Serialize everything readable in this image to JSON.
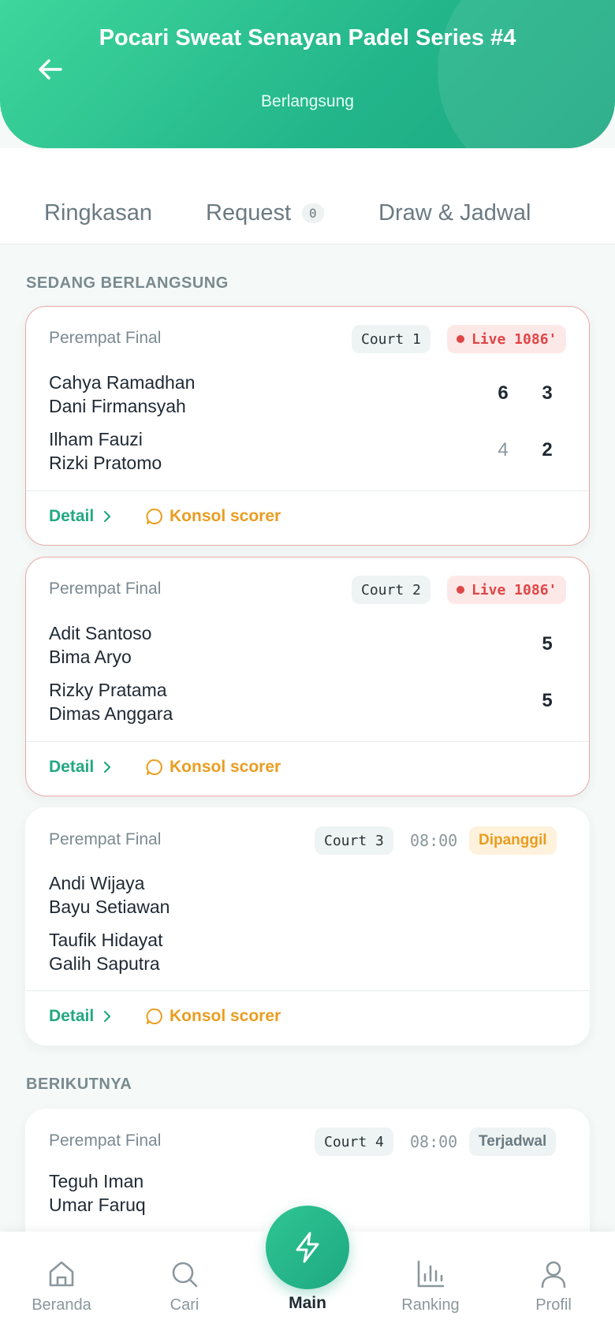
{
  "header": {
    "title": "Pocari Sweat Senayan Padel Series #4",
    "status": "Berlangsung"
  },
  "tabs": [
    {
      "label": "Ringkasan"
    },
    {
      "label": "Request",
      "count": "0"
    },
    {
      "label": "Draw & Jadwal"
    }
  ],
  "sections": {
    "ongoing": "SEDANG BERLANGSUNG",
    "next": "BERIKUTNYA"
  },
  "matches": [
    {
      "round": "Perempat Final",
      "court": "Court 1",
      "status": "Live 1086'",
      "team1": [
        "Cahya Ramadhan",
        "Dani Firmansyah"
      ],
      "team2": [
        "Ilham Fauzi",
        "Rizki Pratomo"
      ],
      "score1": [
        "6",
        "3"
      ],
      "score2": [
        "4",
        "2"
      ],
      "detail": "Detail",
      "scorer": "Konsol scorer"
    },
    {
      "round": "Perempat Final",
      "court": "Court 2",
      "status": "Live 1086'",
      "team1": [
        "Adit Santoso",
        "Bima Aryo"
      ],
      "team2": [
        "Rizky Pratama",
        "Dimas Anggara"
      ],
      "score1": [
        "5"
      ],
      "score2": [
        "5"
      ],
      "detail": "Detail",
      "scorer": "Konsol scorer"
    },
    {
      "round": "Perempat Final",
      "court": "Court 3",
      "time": "08:00",
      "status": "Dipanggil",
      "team1": [
        "Andi Wijaya",
        "Bayu Setiawan"
      ],
      "team2": [
        "Taufik Hidayat",
        "Galih Saputra"
      ],
      "detail": "Detail",
      "scorer": "Konsol scorer"
    },
    {
      "round": "Perempat Final",
      "court": "Court 4",
      "time": "08:00",
      "status": "Terjadwal",
      "team1": [
        "Teguh Iman",
        "Umar Faruq"
      ]
    }
  ],
  "nav": {
    "home": "Beranda",
    "search": "Cari",
    "main": "Main",
    "ranking": "Ranking",
    "profile": "Profil"
  },
  "colors": {
    "primary": "#22b58a",
    "live": "#e04646",
    "warning": "#ea9d20"
  }
}
